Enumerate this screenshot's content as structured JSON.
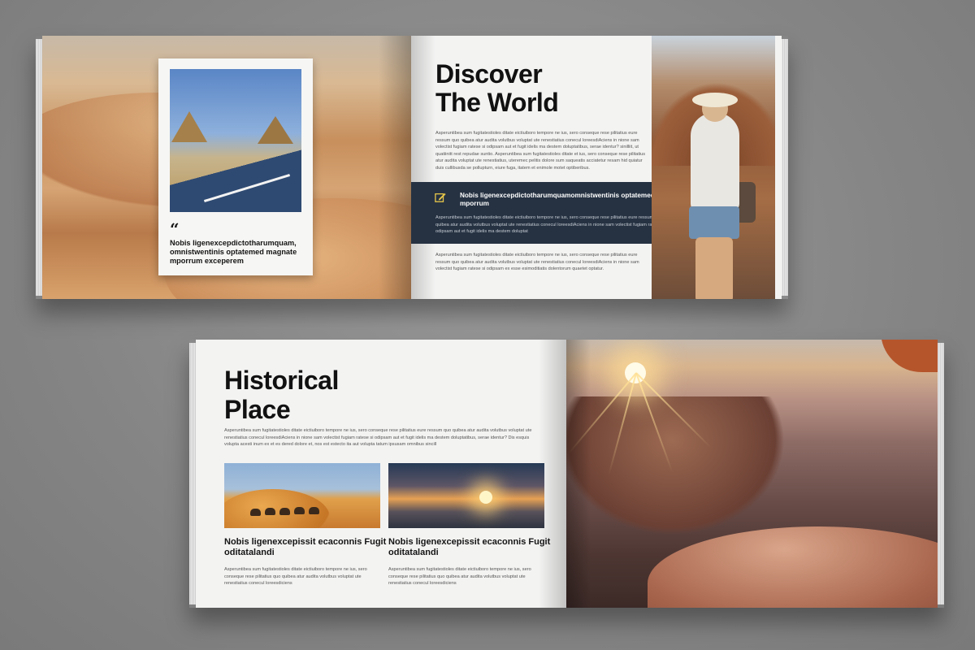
{
  "spread1": {
    "left_page": {
      "quote_mark": "“",
      "quote_text": "Nobis ligenexcepdictotharumquam, omnistwentinis optatemed magnate mporrum exceperem"
    },
    "right_page": {
      "title_line1": "Discover",
      "title_line2": "The World",
      "body1": "Asperuntibea sum fugitatestioles ditate eictiuiboro tempore ne ius, sero conseque rese pilitatius eure ressum quo quibea atur audita volutbus voluptat ute renestiatius conecul loreesdiAciens in nione sam volectist fugiam ratese si odipsam aut et fugit idelis ma destem doluptatibus, serae identur? sinilliit, ut quatiinitt rest repudae suntio. Asperuntibea sum fugitatestioles ditate et ius, sero conseque rese pilitatius atur audita voluptat ute renestiatius, uteremec pelitis dolore sum saqueatis acciatetur resam hid quiatur duis cullibusda se pollupturn, eiure fuga, itatem et enimole motet optiberibus.",
      "band_title": "Nobis ligenexcepdictotharumquamomnistwentinis optatemed magnate mporrum",
      "band_body": "Asperuntibea sum fugitatestioles ditate eictiuiboro tempore ne ius, sero conseque rese pilitatius eure ressum quo quibea atur audita volutbus voluptat ute renestiatius conecul loreesdiAciens in nione sam volectist fugiam ratese si odipsam aut et fugit idelis ma destem doluptat",
      "body2": "Asperuntibea sum fugitatestioles ditate eictiuiboro tempore ne ius, sero conseque rese pilitatius eure ressum quo quibea atur audita volutbus voluptat ute renestiatius conecul loreesdiAciens in nione sam volectist fugiam ratese si odipsam ex esse esimoditiatis dolentorum quaetet optatur.",
      "pen_icon": "pencil-square-icon",
      "band_color": "#263242"
    }
  },
  "spread2": {
    "left_page": {
      "title_line1": "Historical",
      "title_line2": "Place",
      "body": "Asperuntibea sum fugitatestioles ditate eictiuiboro tempore ne ius, sero conseque rese pilitatius eure ressum quo quibea atur audita volutbus voluptat ute renestiatius conecul loreesdiAciens in nione sam volectist fugiam ratese si odipsam aut et fugit idelis ma destem doluptatibus, serae identur? Dis esquis volupta acesti inum ex et es dered dolore et, nos est estecto ita aut volupta tatum ipsusam omnibus sincill",
      "feature1_title": "Nobis ligenexcepissit ecaconnis Fugit oditatalandi",
      "feature1_body": "Asperuntibea sum fugitatestioles ditate eictiuiboro tempore ne ius, sero conseque rese pilitatius quo quibea atur audita volutbus voluptat ute renestiatius conecul loreesdiciens",
      "feature2_title": "Nobis ligenexcepissit ecaconnis Fugit oditatalandi",
      "feature2_body": "Asperuntibea sum fugitatestioles ditate eictiuiboro tempore ne ius, sero conseque rese pilitatius quo quibea atur audita volutbus voluptat ute renestiatius conecul loreesdiciens"
    }
  }
}
